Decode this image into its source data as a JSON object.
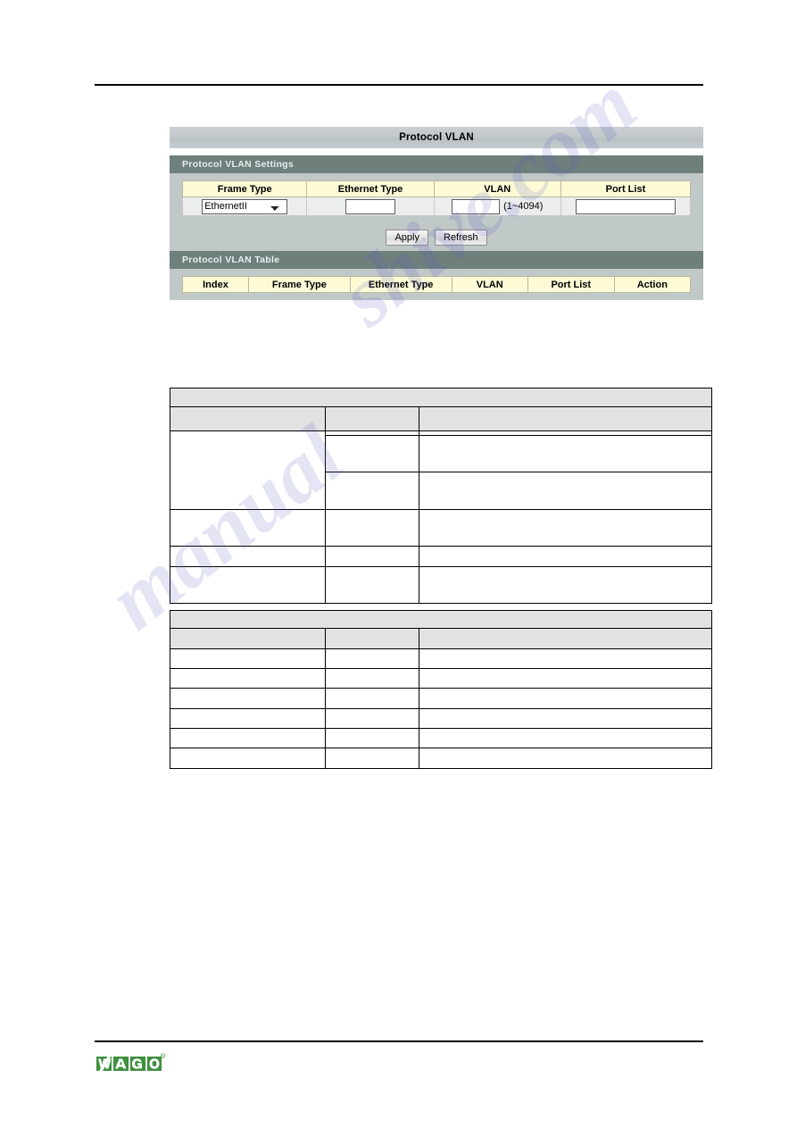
{
  "page": {
    "watermark_left": "manual",
    "watermark_right": "shive.com",
    "brand": "WAGO",
    "brand_trademark": "®"
  },
  "ui": {
    "title": "Protocol VLAN",
    "settings_section": {
      "heading": "Protocol VLAN Settings",
      "columns": [
        "Frame Type",
        "Ethernet Type",
        "VLAN",
        "Port List"
      ],
      "frame_type": {
        "selected": "EthernetII",
        "options": [
          "EthernetII"
        ]
      },
      "ethernet_type": {
        "value": "",
        "placeholder": ""
      },
      "vlan": {
        "value": "",
        "placeholder": "",
        "range_note": "(1~4094)"
      },
      "port_list": {
        "value": "",
        "placeholder": ""
      }
    },
    "buttons": {
      "apply": "Apply",
      "refresh": "Refresh"
    },
    "table_section": {
      "heading": "Protocol VLAN Table",
      "columns": [
        "Index",
        "Frame Type",
        "Ethernet Type",
        "VLAN",
        "Port List",
        "Action"
      ],
      "rows": []
    }
  },
  "doc_table_1": {
    "band": "",
    "header": [
      "",
      "",
      ""
    ],
    "rows": [
      [
        "",
        "",
        ""
      ],
      [
        "",
        "",
        ""
      ],
      [
        "",
        "",
        ""
      ],
      [
        "",
        "",
        ""
      ],
      [
        "",
        "",
        ""
      ],
      [
        "",
        "",
        ""
      ]
    ]
  },
  "doc_table_2": {
    "band": "",
    "header": [
      "",
      "",
      ""
    ],
    "rows": [
      [
        "",
        "",
        ""
      ],
      [
        "",
        "",
        ""
      ],
      [
        "",
        "",
        ""
      ],
      [
        "",
        "",
        ""
      ],
      [
        "",
        "",
        ""
      ],
      [
        "",
        "",
        ""
      ]
    ]
  },
  "colors": {
    "titlebar": "#c2c8cb",
    "panel": "#c0c8c8",
    "section_head": "#6e7f7c",
    "table_header": "#fdfbd6",
    "cell": "#eceeed",
    "doc_shade": "#e2e2e2",
    "brand_green": "#3f8f3f",
    "rule": "#000000"
  }
}
